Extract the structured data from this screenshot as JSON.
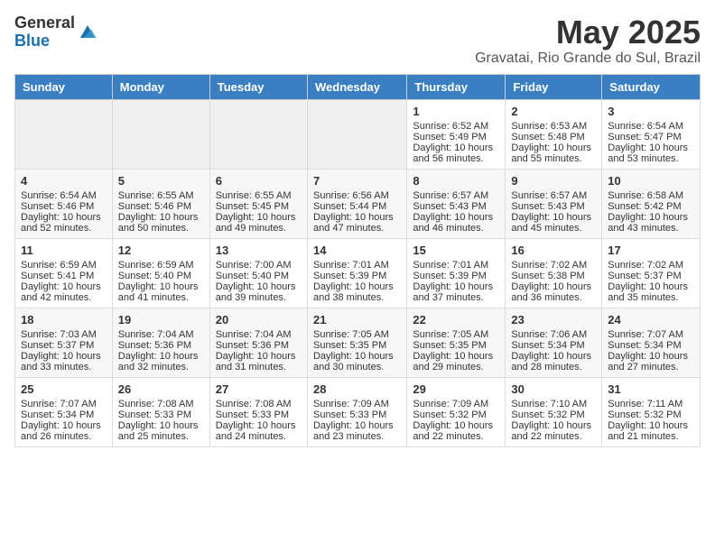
{
  "logo": {
    "general": "General",
    "blue": "Blue"
  },
  "title": "May 2025",
  "location": "Gravatai, Rio Grande do Sul, Brazil",
  "days_of_week": [
    "Sunday",
    "Monday",
    "Tuesday",
    "Wednesday",
    "Thursday",
    "Friday",
    "Saturday"
  ],
  "weeks": [
    [
      {
        "day": "",
        "info": ""
      },
      {
        "day": "",
        "info": ""
      },
      {
        "day": "",
        "info": ""
      },
      {
        "day": "",
        "info": ""
      },
      {
        "day": "1",
        "info": "Sunrise: 6:52 AM\nSunset: 5:49 PM\nDaylight: 10 hours and 56 minutes."
      },
      {
        "day": "2",
        "info": "Sunrise: 6:53 AM\nSunset: 5:48 PM\nDaylight: 10 hours and 55 minutes."
      },
      {
        "day": "3",
        "info": "Sunrise: 6:54 AM\nSunset: 5:47 PM\nDaylight: 10 hours and 53 minutes."
      }
    ],
    [
      {
        "day": "4",
        "info": "Sunrise: 6:54 AM\nSunset: 5:46 PM\nDaylight: 10 hours and 52 minutes."
      },
      {
        "day": "5",
        "info": "Sunrise: 6:55 AM\nSunset: 5:46 PM\nDaylight: 10 hours and 50 minutes."
      },
      {
        "day": "6",
        "info": "Sunrise: 6:55 AM\nSunset: 5:45 PM\nDaylight: 10 hours and 49 minutes."
      },
      {
        "day": "7",
        "info": "Sunrise: 6:56 AM\nSunset: 5:44 PM\nDaylight: 10 hours and 47 minutes."
      },
      {
        "day": "8",
        "info": "Sunrise: 6:57 AM\nSunset: 5:43 PM\nDaylight: 10 hours and 46 minutes."
      },
      {
        "day": "9",
        "info": "Sunrise: 6:57 AM\nSunset: 5:43 PM\nDaylight: 10 hours and 45 minutes."
      },
      {
        "day": "10",
        "info": "Sunrise: 6:58 AM\nSunset: 5:42 PM\nDaylight: 10 hours and 43 minutes."
      }
    ],
    [
      {
        "day": "11",
        "info": "Sunrise: 6:59 AM\nSunset: 5:41 PM\nDaylight: 10 hours and 42 minutes."
      },
      {
        "day": "12",
        "info": "Sunrise: 6:59 AM\nSunset: 5:40 PM\nDaylight: 10 hours and 41 minutes."
      },
      {
        "day": "13",
        "info": "Sunrise: 7:00 AM\nSunset: 5:40 PM\nDaylight: 10 hours and 39 minutes."
      },
      {
        "day": "14",
        "info": "Sunrise: 7:01 AM\nSunset: 5:39 PM\nDaylight: 10 hours and 38 minutes."
      },
      {
        "day": "15",
        "info": "Sunrise: 7:01 AM\nSunset: 5:39 PM\nDaylight: 10 hours and 37 minutes."
      },
      {
        "day": "16",
        "info": "Sunrise: 7:02 AM\nSunset: 5:38 PM\nDaylight: 10 hours and 36 minutes."
      },
      {
        "day": "17",
        "info": "Sunrise: 7:02 AM\nSunset: 5:37 PM\nDaylight: 10 hours and 35 minutes."
      }
    ],
    [
      {
        "day": "18",
        "info": "Sunrise: 7:03 AM\nSunset: 5:37 PM\nDaylight: 10 hours and 33 minutes."
      },
      {
        "day": "19",
        "info": "Sunrise: 7:04 AM\nSunset: 5:36 PM\nDaylight: 10 hours and 32 minutes."
      },
      {
        "day": "20",
        "info": "Sunrise: 7:04 AM\nSunset: 5:36 PM\nDaylight: 10 hours and 31 minutes."
      },
      {
        "day": "21",
        "info": "Sunrise: 7:05 AM\nSunset: 5:35 PM\nDaylight: 10 hours and 30 minutes."
      },
      {
        "day": "22",
        "info": "Sunrise: 7:05 AM\nSunset: 5:35 PM\nDaylight: 10 hours and 29 minutes."
      },
      {
        "day": "23",
        "info": "Sunrise: 7:06 AM\nSunset: 5:34 PM\nDaylight: 10 hours and 28 minutes."
      },
      {
        "day": "24",
        "info": "Sunrise: 7:07 AM\nSunset: 5:34 PM\nDaylight: 10 hours and 27 minutes."
      }
    ],
    [
      {
        "day": "25",
        "info": "Sunrise: 7:07 AM\nSunset: 5:34 PM\nDaylight: 10 hours and 26 minutes."
      },
      {
        "day": "26",
        "info": "Sunrise: 7:08 AM\nSunset: 5:33 PM\nDaylight: 10 hours and 25 minutes."
      },
      {
        "day": "27",
        "info": "Sunrise: 7:08 AM\nSunset: 5:33 PM\nDaylight: 10 hours and 24 minutes."
      },
      {
        "day": "28",
        "info": "Sunrise: 7:09 AM\nSunset: 5:33 PM\nDaylight: 10 hours and 23 minutes."
      },
      {
        "day": "29",
        "info": "Sunrise: 7:09 AM\nSunset: 5:32 PM\nDaylight: 10 hours and 22 minutes."
      },
      {
        "day": "30",
        "info": "Sunrise: 7:10 AM\nSunset: 5:32 PM\nDaylight: 10 hours and 22 minutes."
      },
      {
        "day": "31",
        "info": "Sunrise: 7:11 AM\nSunset: 5:32 PM\nDaylight: 10 hours and 21 minutes."
      }
    ]
  ]
}
